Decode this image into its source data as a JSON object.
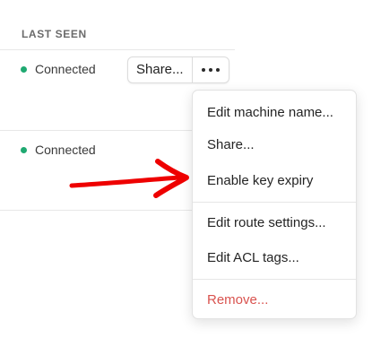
{
  "table": {
    "column_header": "LAST SEEN",
    "rows": [
      {
        "status": "Connected",
        "status_color": "#1fa971"
      },
      {
        "status": "Connected",
        "status_color": "#1fa971"
      }
    ]
  },
  "actions": {
    "share_label": "Share...",
    "more_icon": "ellipsis-icon"
  },
  "context_menu": {
    "items": [
      {
        "label": "Edit machine name..."
      },
      {
        "label": "Share..."
      },
      {
        "label": "Enable key expiry"
      },
      {
        "label": "Edit route settings..."
      },
      {
        "label": "Edit ACL tags..."
      },
      {
        "label": "Remove...",
        "color": "#d9534f"
      }
    ]
  },
  "annotation": {
    "arrow_color": "#ee0000"
  }
}
